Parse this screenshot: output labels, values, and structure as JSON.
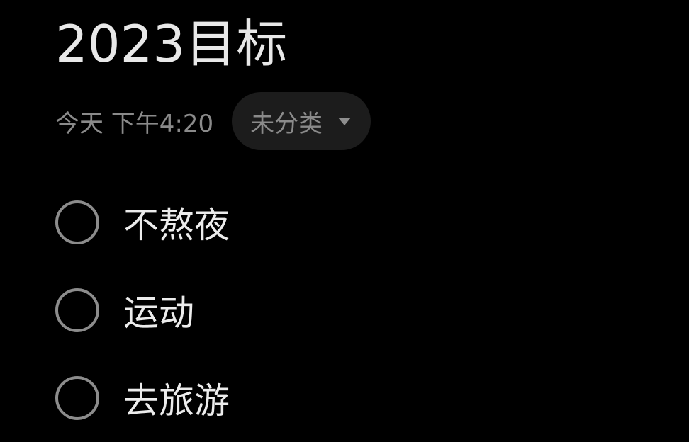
{
  "note": {
    "title": "2023目标",
    "timestamp": "今天 下午4:20",
    "category": "未分类",
    "category_icon": "chevron-down-icon"
  },
  "todos": [
    {
      "text": "不熬夜",
      "checked": false
    },
    {
      "text": "运动",
      "checked": false
    },
    {
      "text": "去旅游",
      "checked": false
    }
  ],
  "colors": {
    "background": "#000000",
    "title_text": "#e8e8e8",
    "secondary_text": "#8a8a8a",
    "chip_background": "#1c1c1c",
    "checkbox_border": "#8c8c8c",
    "item_text": "#ececec"
  }
}
